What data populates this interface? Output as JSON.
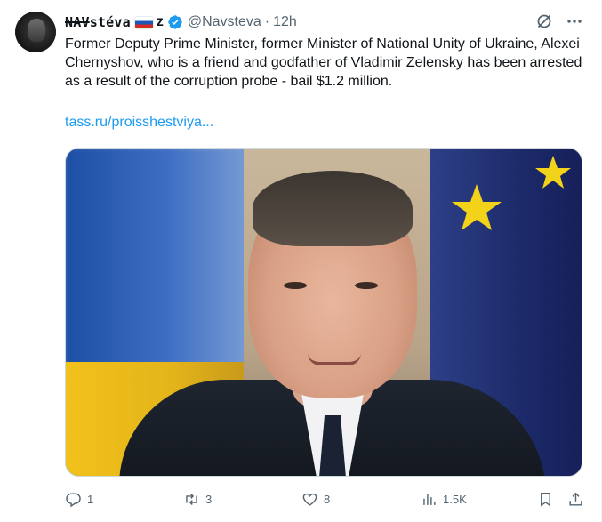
{
  "tweet": {
    "author": {
      "display_name_prefix": "NAV",
      "display_name_rest": "stéva",
      "flag": "russian-flag",
      "suffix": "z",
      "verified": true,
      "handle": "@Navsteva",
      "separator": "·",
      "time": "12h"
    },
    "text": "Former Deputy Prime Minister, former Minister of National Unity of Ukraine, Alexei Chernyshov, who is a friend and godfather of Vladimir Zelensky has been arrested as a result of the corruption probe - bail $1.2 million.",
    "link_text": "tass.ru/proisshestviya...",
    "media": {
      "description_icon": "photo"
    },
    "stats": {
      "replies": "1",
      "retweets": "3",
      "likes": "8",
      "views": "1.5K"
    }
  },
  "colors": {
    "text": "#0f1419",
    "secondary": "#536471",
    "link": "#1d9bf0",
    "verified": "#1d9bf0"
  }
}
